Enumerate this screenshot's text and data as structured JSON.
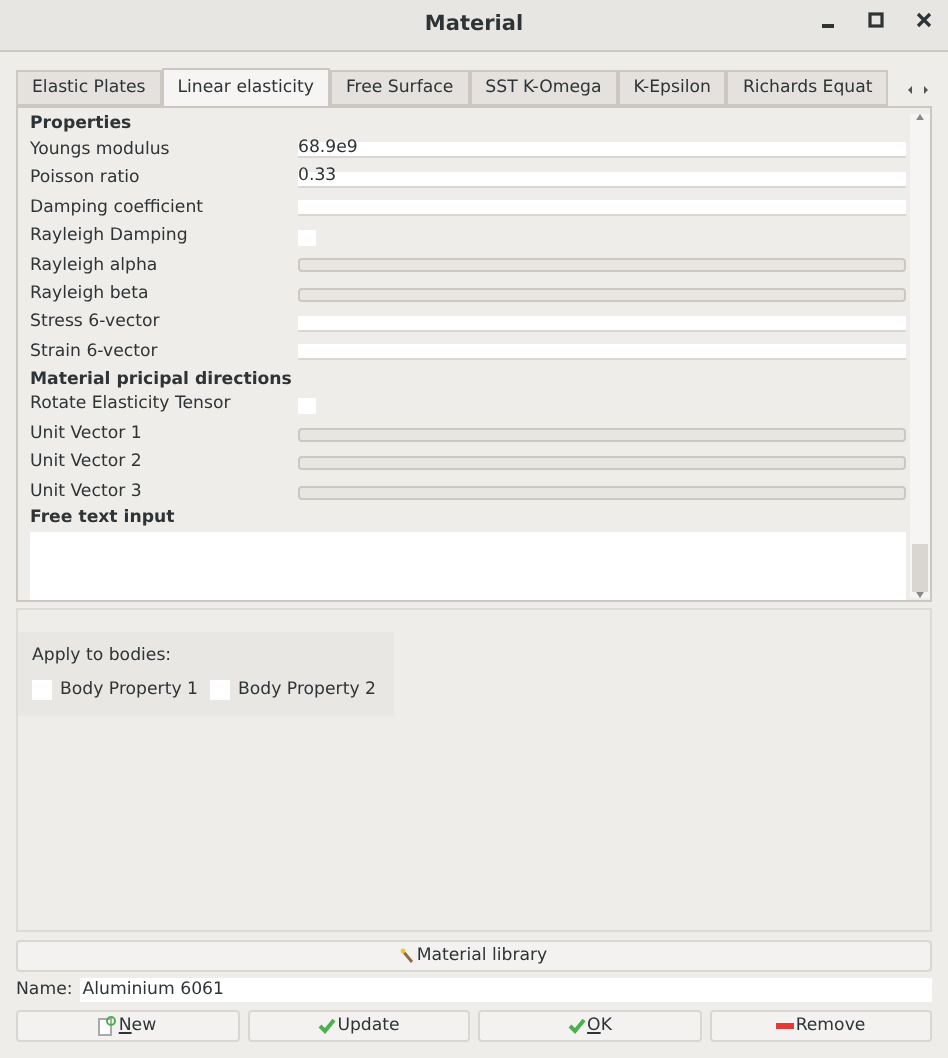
{
  "window": {
    "title": "Material"
  },
  "tabs": [
    {
      "label": "Elastic Plates",
      "selected": false
    },
    {
      "label": "Linear elasticity",
      "selected": true
    },
    {
      "label": "Free Surface",
      "selected": false
    },
    {
      "label": "SST K-Omega",
      "selected": false
    },
    {
      "label": "K-Epsilon",
      "selected": false
    },
    {
      "label": "Richards Equat",
      "selected": false
    }
  ],
  "properties": [
    {
      "kind": "section",
      "label": "Properties"
    },
    {
      "kind": "field",
      "label": "Youngs modulus",
      "value": "68.9e9",
      "disabled": false
    },
    {
      "kind": "field",
      "label": "Poisson ratio",
      "value": "0.33",
      "disabled": false
    },
    {
      "kind": "field",
      "label": "Damping coefficient",
      "disabled": false
    },
    {
      "kind": "check",
      "label": "Rayleigh Damping",
      "checked": false
    },
    {
      "kind": "field",
      "label": "Rayleigh alpha",
      "disabled": true
    },
    {
      "kind": "field",
      "label": "Rayleigh beta",
      "disabled": true
    },
    {
      "kind": "field",
      "label": "Stress 6-vector",
      "disabled": false
    },
    {
      "kind": "field",
      "label": "Strain 6-vector",
      "disabled": false
    },
    {
      "kind": "section",
      "label": "Material pricipal directions"
    },
    {
      "kind": "check",
      "label": "Rotate Elasticity Tensor",
      "checked": false
    },
    {
      "kind": "field",
      "label": "Unit Vector 1",
      "disabled": true
    },
    {
      "kind": "field",
      "label": "Unit Vector 2",
      "disabled": true
    },
    {
      "kind": "field",
      "label": "Unit Vector 3",
      "disabled": true
    },
    {
      "kind": "section",
      "label": "Free text input"
    }
  ],
  "bodies": {
    "label": "Apply to bodies:",
    "items": [
      {
        "label": "Body Property 1",
        "checked": false
      },
      {
        "label": "Body Property 2",
        "checked": false
      }
    ]
  },
  "library_button": "Material library",
  "name": {
    "label": "Name:",
    "value": "Aluminium 6061"
  },
  "buttons": [
    {
      "kind": "new",
      "label": "New",
      "mnemonic": true
    },
    {
      "kind": "update",
      "label": "Update"
    },
    {
      "kind": "ok",
      "label": "OK",
      "mnemonic": true
    },
    {
      "kind": "remove",
      "label": "Remove"
    }
  ]
}
